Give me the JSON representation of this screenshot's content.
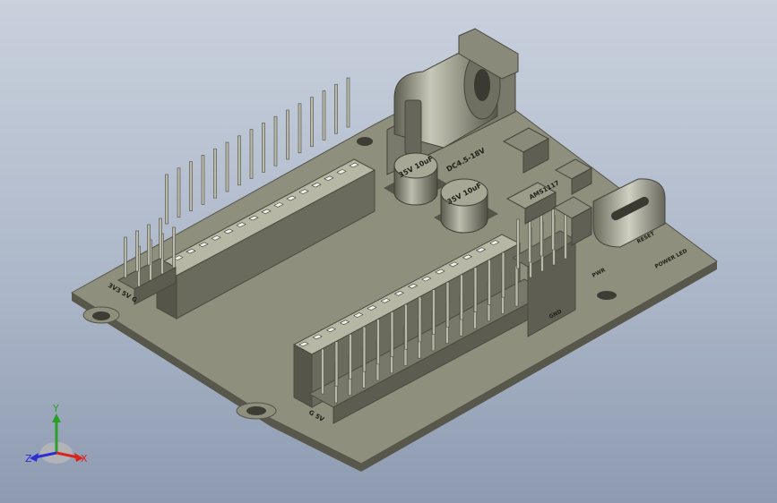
{
  "view": {
    "type": "cad-3d-model-viewport",
    "background_top": "#c9d1dd",
    "background_bottom": "#8d9ab0",
    "board_color": "#8f8f7e",
    "component_color": "#727262"
  },
  "board_labels": {
    "input_voltage": "DC4.5-18V",
    "cap_top": "35V 10uF",
    "cap_bottom": "35V 10uF",
    "regulator": "AMS1117",
    "side_a": "PWR",
    "side_b": "RESET",
    "side_c": "POWER LED",
    "header_left": "3V3 5V G",
    "header_right": "G 5V",
    "pin_group": "GND"
  },
  "axis_triad": {
    "x_label": "X",
    "y_label": "Y",
    "z_label": "Z",
    "x_color": "#d9241c",
    "y_color": "#2aa02a",
    "z_color": "#2d2fd0"
  }
}
